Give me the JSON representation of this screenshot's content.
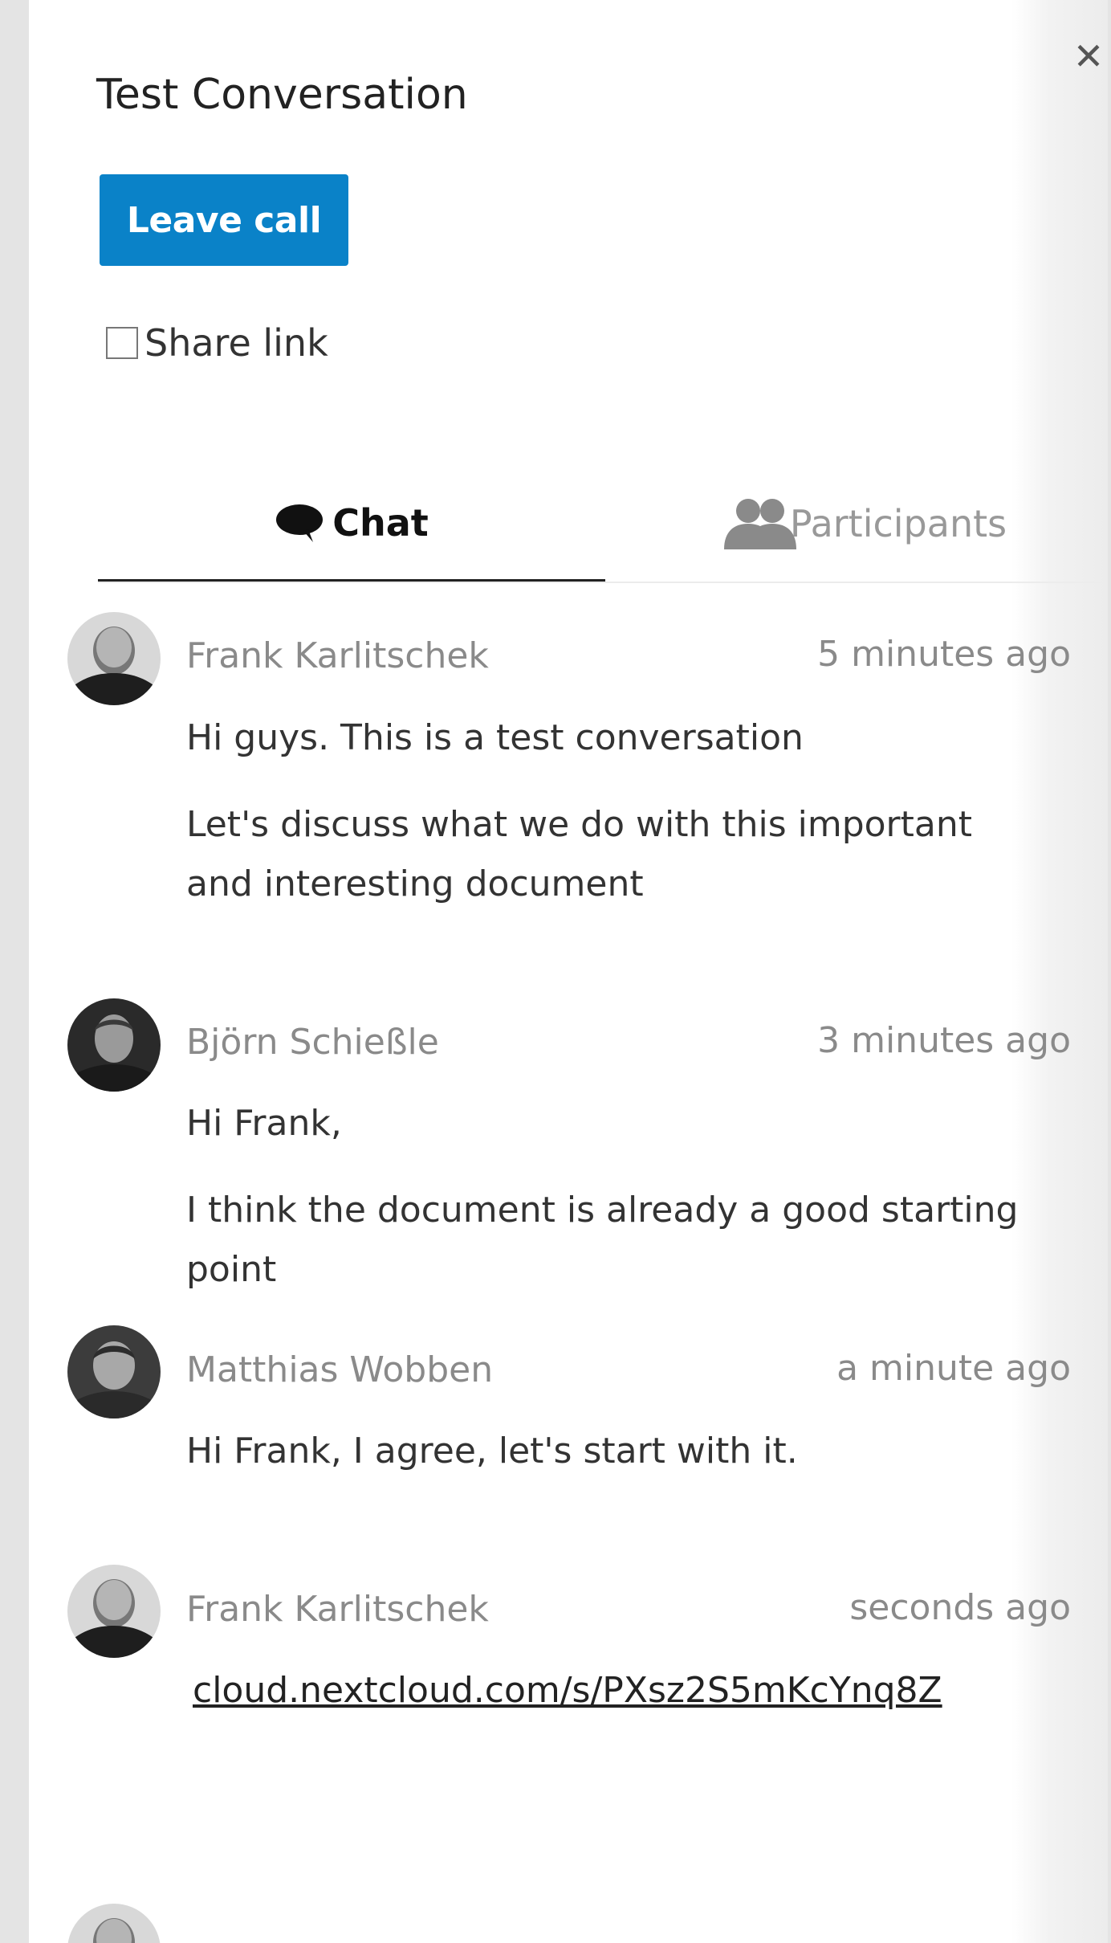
{
  "header": {
    "title": "Test Conversation",
    "close_icon": "close-icon",
    "leave_call_label": "Leave call",
    "share_link_label": "Share link",
    "share_link_checked": false
  },
  "tabs": [
    {
      "label": "Chat",
      "icon": "chat-bubble-icon",
      "active": true
    },
    {
      "label": "Participants",
      "icon": "participants-icon",
      "active": false
    }
  ],
  "messages": [
    {
      "author": "Frank Karlitschek",
      "time": "5 minutes ago",
      "lines": [
        "Hi guys. This is a test conversation",
        "Let's discuss what we do with this important and interesting document"
      ]
    },
    {
      "author": "Björn Schießle",
      "time": "3 minutes ago",
      "lines": [
        "Hi Frank,",
        "I think the document is already a good starting point"
      ]
    },
    {
      "author": "Matthias Wobben",
      "time": "a minute ago",
      "lines": [
        "Hi Frank, I agree, let's start with it."
      ]
    },
    {
      "author": "Frank Karlitschek",
      "time": "seconds ago",
      "link": "cloud.nextcloud.com/s/PXsz2S5mKcYnq8Z"
    }
  ],
  "colors": {
    "accent": "#0a82c8",
    "background": "#e4e4e4",
    "panel": "#ffffff"
  }
}
